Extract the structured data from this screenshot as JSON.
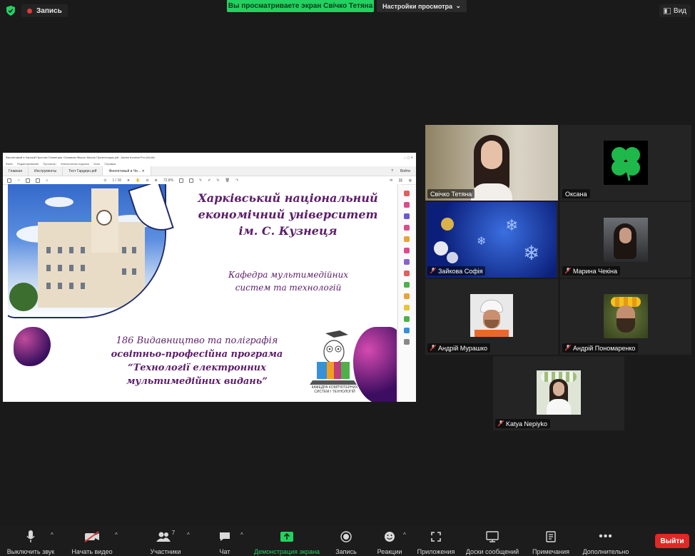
{
  "topbar": {
    "record_label": "Запись",
    "share_banner": "Вы просматриваете экран Свічко Тетяна",
    "view_options": "Настройки просмотра",
    "view_button": "Вид"
  },
  "shared_screen": {
    "window_title": "Фиолетовый и Черный Простая Геометрия Основная Мысль Мысль Презентация.pdf - Adobe Acrobat Pro (64-bit)",
    "menu": [
      "Файл",
      "Редактирование",
      "Просмотр",
      "Электронная подпись",
      "Окно",
      "Справка"
    ],
    "tabs": [
      "Главная",
      "Инструменты",
      "Тест Гардерн.pdf",
      "Фиолетовый и Че..."
    ],
    "tab_right": [
      "?",
      "Войти"
    ],
    "page_counter": "1 / 16",
    "zoom": "72,8%",
    "slide": {
      "title_lines": [
        "Харківський національний",
        "економічний університет",
        "ім. С. Кузнеця"
      ],
      "department_lines": [
        "Кафедра мультимедійних",
        "систем та технологій"
      ],
      "program_lines": [
        "186 Видавництво та поліграфія",
        "освітньо-професійна програма",
        "“Технології електронних",
        "мультимедійних видань”"
      ],
      "logo_text_lines": [
        "КАФЕДРА КОМП'ЮТЕРНИХ",
        "СИСТЕМ І ТЕХНОЛОГІЙ"
      ]
    }
  },
  "gallery": [
    {
      "name": "Свічко Тетяна",
      "muted": false,
      "speaking": true
    },
    {
      "name": "Оксана",
      "muted": false,
      "speaking": false
    },
    {
      "name": "Зайкова Софія",
      "muted": true,
      "speaking": false
    },
    {
      "name": "Марина Чекіна",
      "muted": true,
      "speaking": false
    },
    {
      "name": "Андрій Мурашко",
      "muted": true,
      "speaking": false
    },
    {
      "name": "Андрій Пономаренко",
      "muted": true,
      "speaking": false
    },
    {
      "name": "Katya Nepiyko",
      "muted": true,
      "speaking": false
    }
  ],
  "toolbar": {
    "mute": "Выключить звук",
    "video": "Начать видео",
    "participants": "Участники",
    "participants_count": "7",
    "chat": "Чат",
    "share": "Демонстрация экрана",
    "record": "Запись",
    "reactions": "Реакции",
    "apps": "Приложения",
    "whiteboards": "Доски сообщений",
    "notes": "Примечания",
    "more": "Дополнительно",
    "end": "Выйти"
  },
  "colors": {
    "share_green": "#23d160",
    "speaker_outline": "#c9df3b",
    "end_red": "#e02828",
    "slide_purple": "#5c1d6b"
  }
}
